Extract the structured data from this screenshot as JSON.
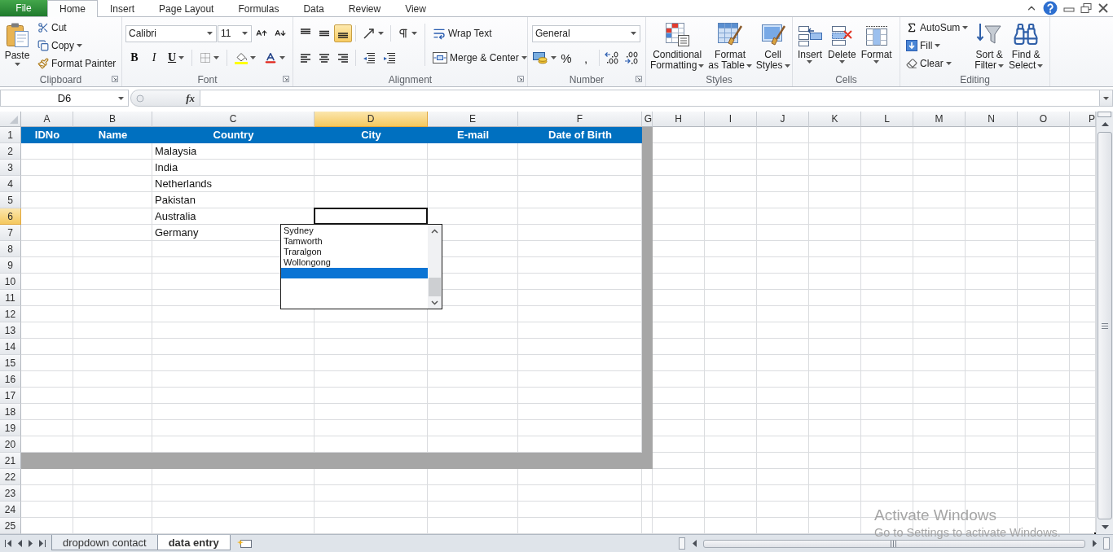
{
  "tabs": [
    {
      "label": "File",
      "kind": "file",
      "selected": false
    },
    {
      "label": "Home",
      "kind": "tab",
      "selected": true
    },
    {
      "label": "Insert",
      "kind": "tab",
      "selected": false
    },
    {
      "label": "Page Layout",
      "kind": "tab",
      "selected": false
    },
    {
      "label": "Formulas",
      "kind": "tab",
      "selected": false
    },
    {
      "label": "Data",
      "kind": "tab",
      "selected": false
    },
    {
      "label": "Review",
      "kind": "tab",
      "selected": false
    },
    {
      "label": "View",
      "kind": "tab",
      "selected": false
    }
  ],
  "ribbon": {
    "clipboard": {
      "label": "Clipboard",
      "paste": "Paste",
      "cut": "Cut",
      "copy": "Copy",
      "format_painter": "Format Painter"
    },
    "font": {
      "label": "Font",
      "font_name": "Calibri",
      "font_size": "11",
      "styles": [
        {
          "kind": "bold",
          "label": "B"
        },
        {
          "kind": "italic",
          "label": "I"
        },
        {
          "kind": "underline",
          "label": "U"
        }
      ]
    },
    "alignment": {
      "label": "Alignment",
      "vertical": [
        {
          "kind": "top",
          "selected": false
        },
        {
          "kind": "middle",
          "selected": false
        },
        {
          "kind": "bottom",
          "selected": true
        }
      ],
      "horizontal": [
        {
          "kind": "left",
          "selected": false
        },
        {
          "kind": "center",
          "selected": false
        },
        {
          "kind": "right",
          "selected": false
        }
      ],
      "wrap_text": "Wrap Text",
      "merge_center": "Merge & Center"
    },
    "number": {
      "label": "Number",
      "format": "General",
      "percent": "%",
      "comma": ","
    },
    "styles": {
      "label": "Styles",
      "buttons": [
        {
          "kind": "conditional",
          "lines": [
            "Conditional",
            "Formatting"
          ]
        },
        {
          "kind": "table",
          "lines": [
            "Format",
            "as Table"
          ]
        },
        {
          "kind": "cell",
          "lines": [
            "Cell",
            "Styles"
          ]
        }
      ]
    },
    "cells": {
      "label": "Cells",
      "buttons": [
        {
          "kind": "insert",
          "label": "Insert"
        },
        {
          "kind": "delete",
          "label": "Delete"
        },
        {
          "kind": "format",
          "label": "Format"
        }
      ]
    },
    "editing": {
      "label": "Editing",
      "autosum": "AutoSum",
      "fill": "Fill",
      "clear": "Clear",
      "sort_filter": [
        "Sort &",
        "Filter"
      ],
      "find_select": [
        "Find &",
        "Select"
      ]
    }
  },
  "formula_bar": {
    "name_box": "D6",
    "function_button": "fx"
  },
  "sheet": {
    "columns": [
      {
        "letter": "A",
        "selected": false
      },
      {
        "letter": "B",
        "selected": false
      },
      {
        "letter": "C",
        "selected": false
      },
      {
        "letter": "D",
        "selected": true
      },
      {
        "letter": "E",
        "selected": false
      },
      {
        "letter": "F",
        "selected": false
      },
      {
        "letter": "G",
        "selected": false
      },
      {
        "letter": "H",
        "selected": false
      },
      {
        "letter": "I",
        "selected": false
      },
      {
        "letter": "J",
        "selected": false
      },
      {
        "letter": "K",
        "selected": false
      },
      {
        "letter": "L",
        "selected": false
      },
      {
        "letter": "M",
        "selected": false
      },
      {
        "letter": "N",
        "selected": false
      },
      {
        "letter": "O",
        "selected": false
      },
      {
        "letter": "P",
        "selected": false
      }
    ],
    "rows": [
      {
        "number": "1",
        "kind": "header",
        "selected": false,
        "cells": [
          "IDNo",
          "Name",
          "Country",
          "City",
          "E-mail",
          "Date of Birth"
        ]
      },
      {
        "number": "2",
        "kind": "data",
        "selected": false,
        "country": "Malaysia"
      },
      {
        "number": "3",
        "kind": "data",
        "selected": false,
        "country": "India"
      },
      {
        "number": "4",
        "kind": "data",
        "selected": false,
        "country": "Netherlands"
      },
      {
        "number": "5",
        "kind": "data",
        "selected": false,
        "country": "Pakistan"
      },
      {
        "number": "6",
        "kind": "data",
        "selected": true,
        "country": "Australia"
      },
      {
        "number": "7",
        "kind": "data",
        "selected": false,
        "country": "Germany"
      },
      {
        "number": "8",
        "kind": "data",
        "selected": false
      },
      {
        "number": "9",
        "kind": "data",
        "selected": false
      },
      {
        "number": "10",
        "kind": "data",
        "selected": false
      },
      {
        "number": "11",
        "kind": "data",
        "selected": false
      },
      {
        "number": "12",
        "kind": "data",
        "selected": false
      },
      {
        "number": "13",
        "kind": "data",
        "selected": false
      },
      {
        "number": "14",
        "kind": "data",
        "selected": false
      },
      {
        "number": "15",
        "kind": "data",
        "selected": false
      },
      {
        "number": "16",
        "kind": "data",
        "selected": false
      },
      {
        "number": "17",
        "kind": "data",
        "selected": false
      },
      {
        "number": "18",
        "kind": "data",
        "selected": false
      },
      {
        "number": "19",
        "kind": "data",
        "selected": false
      },
      {
        "number": "20",
        "kind": "data",
        "selected": false
      },
      {
        "number": "21",
        "kind": "border",
        "selected": false
      },
      {
        "number": "22",
        "kind": "plain",
        "selected": false
      },
      {
        "number": "23",
        "kind": "plain",
        "selected": false
      },
      {
        "number": "24",
        "kind": "plain",
        "selected": false
      },
      {
        "number": "25",
        "kind": "plain",
        "selected": false
      }
    ]
  },
  "list_dropdown": {
    "items": [
      {
        "label": "Sydney",
        "selected": false
      },
      {
        "label": "Tamworth",
        "selected": false
      },
      {
        "label": "Traralgon",
        "selected": false
      },
      {
        "label": "Wollongong",
        "selected": false
      },
      {
        "selected": true
      }
    ]
  },
  "sheet_tabs": [
    {
      "label": "dropdown contact",
      "selected": false
    },
    {
      "label": "data entry",
      "selected": true
    }
  ],
  "activation_notice": {
    "title": "Activate Windows",
    "message": "Go to Settings to activate Windows."
  }
}
